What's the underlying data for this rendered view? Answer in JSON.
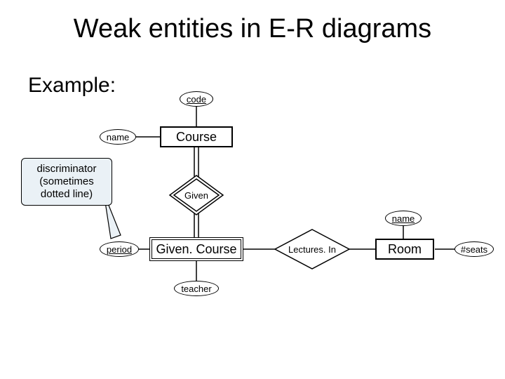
{
  "title": "Weak entities in E-R diagrams",
  "subtitle": "Example:",
  "attrs": {
    "code": "code",
    "name_course": "name",
    "period": "period",
    "teacher": "teacher",
    "name_room": "name",
    "seats": "#seats"
  },
  "entities": {
    "course": "Course",
    "given_course": "Given. Course",
    "room": "Room"
  },
  "relationships": {
    "given": "Given",
    "lectures_in": "Lectures. In"
  },
  "callout": "discriminator\n(sometimes\ndotted line)"
}
